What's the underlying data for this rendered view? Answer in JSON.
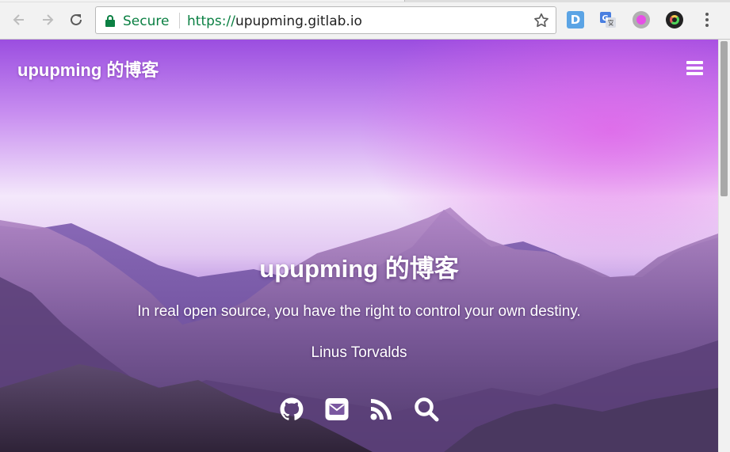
{
  "browser": {
    "secure_label": "Secure",
    "url_scheme": "https://",
    "url_host": "upupming.gitlab.io",
    "extensions": [
      {
        "icon": "d-letter-icon",
        "label": "D"
      },
      {
        "icon": "google-translate-icon",
        "label": "G"
      },
      {
        "icon": "color-circle-icon"
      },
      {
        "icon": "camera-lens-icon"
      }
    ],
    "colors": {
      "secure": "#0b8043"
    }
  },
  "site": {
    "brand": "upupming 的博客",
    "hero_title": "upupming 的博客",
    "quote": "In real open source, you have the right to control your own destiny.",
    "author": "Linus Torvalds",
    "social": [
      {
        "icon": "github-icon"
      },
      {
        "icon": "email-icon"
      },
      {
        "icon": "rss-icon"
      },
      {
        "icon": "search-icon"
      }
    ],
    "colors": {
      "sky_top": "#a24fe0",
      "sky_mid": "#f2e6fb",
      "mountain": "#6b4a8e"
    }
  }
}
